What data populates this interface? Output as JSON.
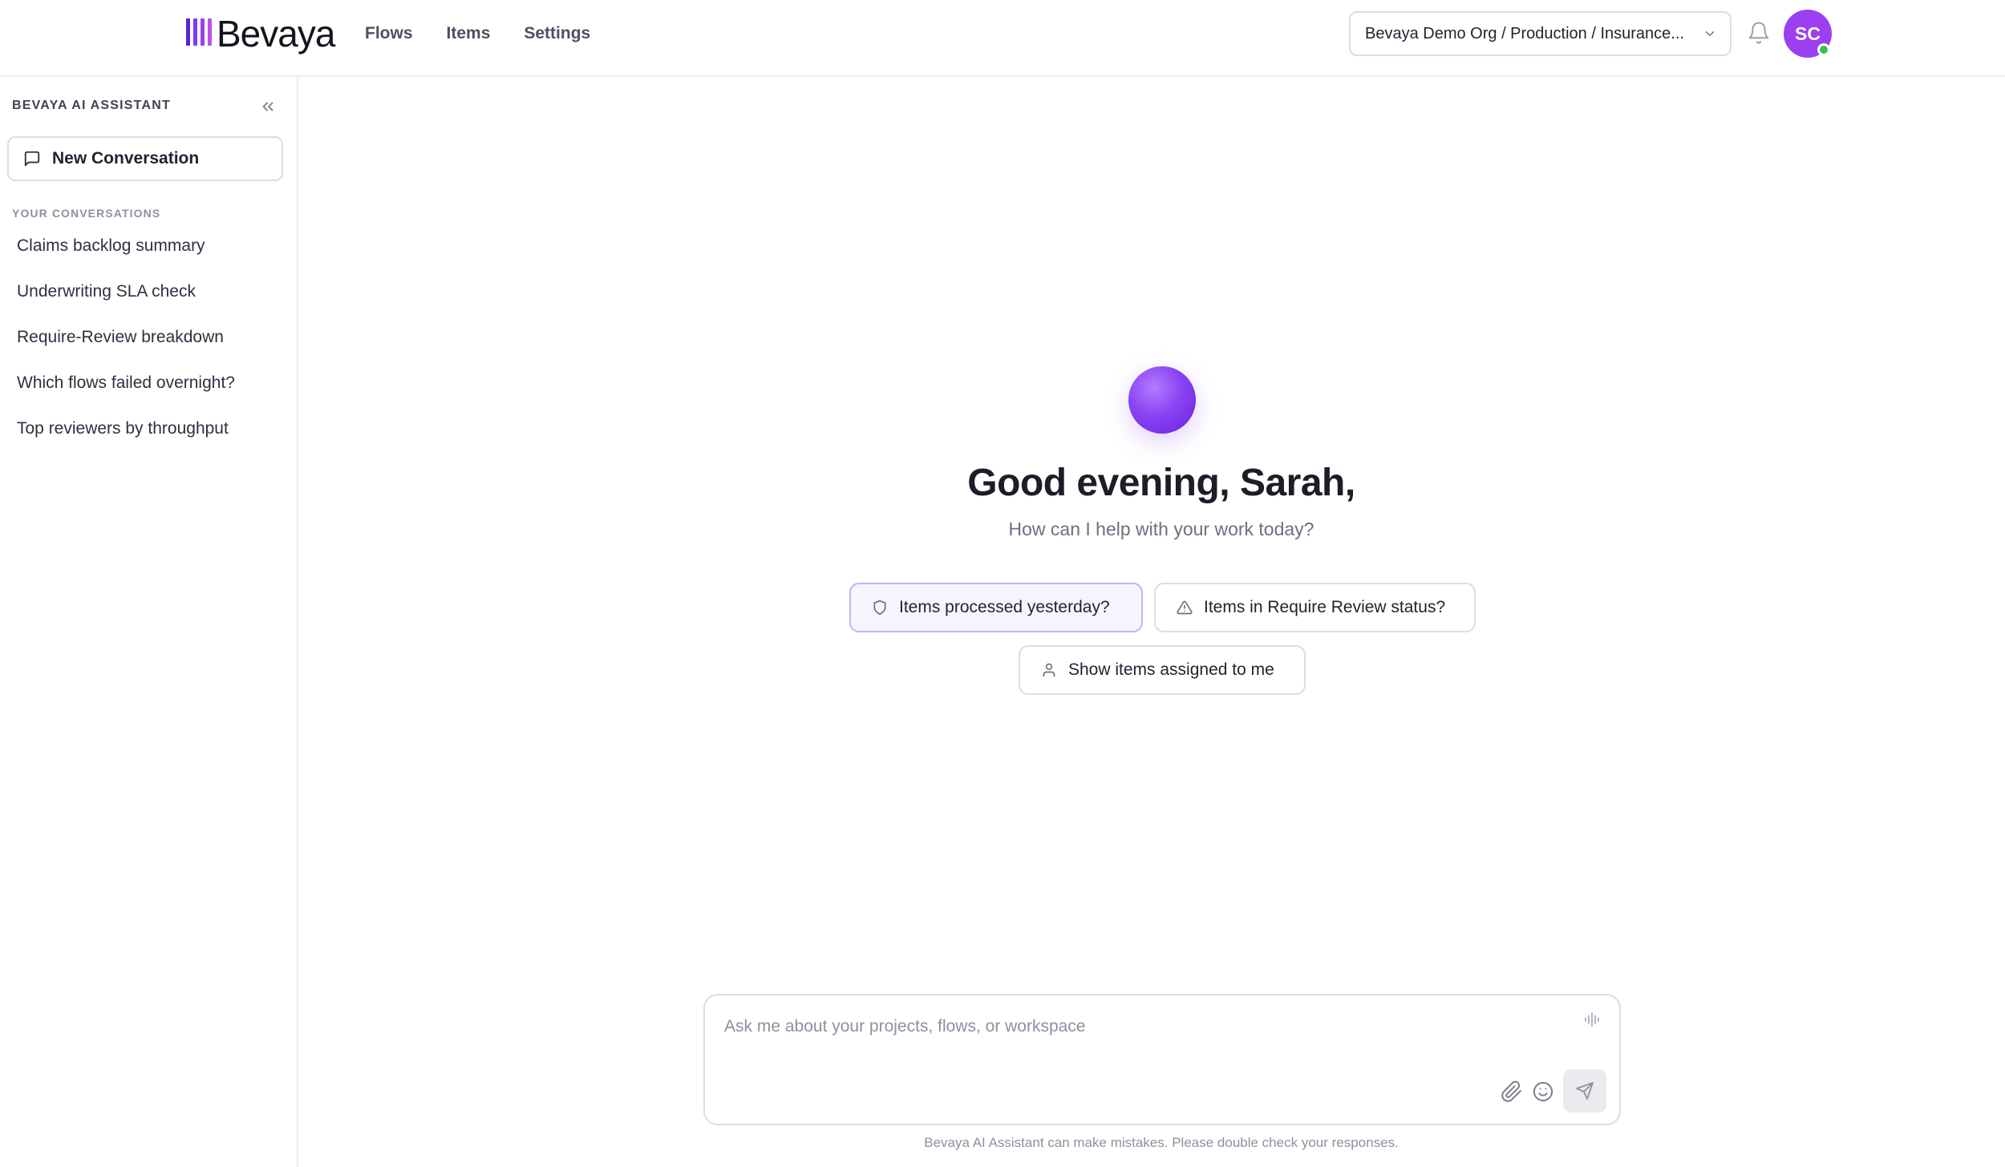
{
  "app": {
    "logo_text": "Bevaya",
    "brand_colors": [
      "#5b22d6",
      "#7c3aed",
      "#9b3ff0",
      "#c04fe6"
    ]
  },
  "nav": {
    "items": [
      "Flows",
      "Items",
      "Settings"
    ]
  },
  "header": {
    "org_selector": "Bevaya Demo Org / Production / Insurance...",
    "avatar_initials": "SC",
    "avatar_color": "#9b3ff0",
    "presence_color": "#3bbf5a"
  },
  "sidebar": {
    "title": "BEVAYA AI ASSISTANT",
    "new_conversation": "New Conversation",
    "section_title": "YOUR CONVERSATIONS",
    "conversations": [
      "Claims backlog summary",
      "Underwriting SLA check",
      "Require-Review breakdown",
      "Which flows failed overnight?",
      "Top reviewers by throughput"
    ]
  },
  "main": {
    "greeting": "Good evening, Sarah,",
    "subtitle": "How can I help with your work today?",
    "suggestions": [
      {
        "label": "Items processed yesterday?",
        "icon": "shield-icon"
      },
      {
        "label": "Items in Require Review status?",
        "icon": "warning-icon"
      },
      {
        "label": "Show items assigned to me",
        "icon": "user-icon"
      }
    ]
  },
  "composer": {
    "placeholder": "Ask me about your projects, flows, or workspace",
    "value": "",
    "disclaimer": "Bevaya AI Assistant can make mistakes. Please double check your responses."
  }
}
